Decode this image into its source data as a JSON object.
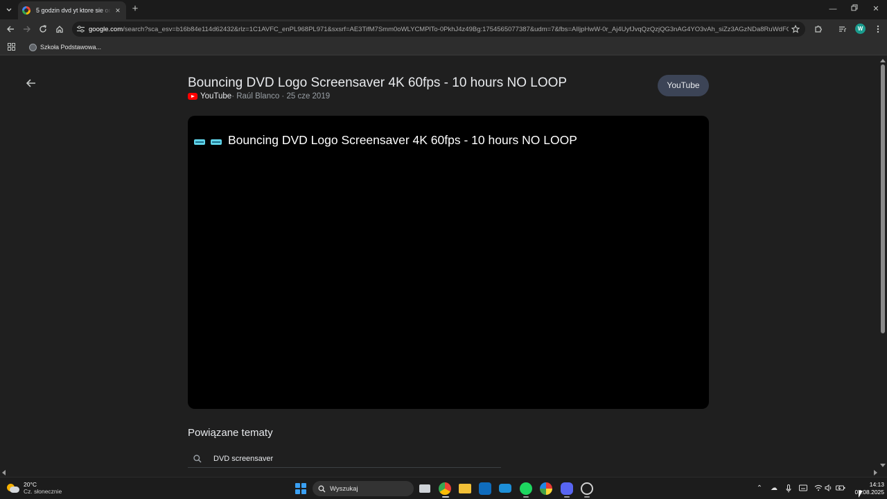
{
  "browser": {
    "tab_title": "5 godzin dvd yt ktore sie odbij...",
    "url_domain": "google.com",
    "url_rest": "/search?sca_esv=b16b84e114d62432&rlz=1C1AVFC_enPL968PL971&sxsrf=AE3TifM7Smm0oWLYCMPlTo-0PkhJ4z49Bg:1754565077387&udm=7&fbs=AIljpHwW-0r_Aj4UyfJvqQzQzjQG3nAG4YO3vAh_siZz3AGzNDa8RuWdFO4UkrHU0...",
    "profile_initial": "W",
    "bookmark": "Szkoła Podstawowa..."
  },
  "page": {
    "video_title": "Bouncing DVD Logo Screensaver 4K 60fps - 10 hours NO LOOP",
    "source": "YouTube",
    "channel": " · Raúl Blanco · 25 cze 2019",
    "open_button": "YouTube",
    "player_title": "Bouncing DVD Logo Screensaver 4K 60fps - 10 hours NO LOOP",
    "related_heading": "Powiązane tematy",
    "related_items": [
      "DVD screensaver"
    ]
  },
  "taskbar": {
    "weather_temp": "20°C",
    "weather_desc": "Cz. słonecznie",
    "search_placeholder": "Wyszukaj",
    "time": "14:13",
    "date": "07.08.2025"
  },
  "icons": {
    "back": "arrow-left-icon",
    "forward": "arrow-right-icon",
    "reload": "reload-icon",
    "home": "home-icon",
    "site_info": "tune-icon",
    "star": "star-icon",
    "extensions": "puzzle-icon",
    "menu": "kebab-icon"
  },
  "colors": {
    "accent_youtube": "#ff0000",
    "button_bg": "#3c4456",
    "profile": "#1a9b8d"
  }
}
